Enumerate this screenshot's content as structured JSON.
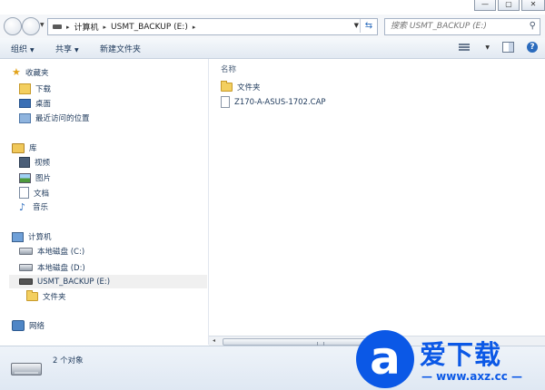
{
  "window": {
    "controls": {
      "minimize": "—",
      "maximize": "▢",
      "close": "✕"
    }
  },
  "addressbar": {
    "breadcrumb": [
      "计算机",
      "USMT_BACKUP (E:)"
    ],
    "search_placeholder": "搜索 USMT_BACKUP (E:)"
  },
  "toolbar": {
    "organize": "组织",
    "share": "共享",
    "new_folder": "新建文件夹"
  },
  "nav": {
    "favorites": "收藏夹",
    "favorite_items": [
      "下载",
      "桌面",
      "最近访问的位置"
    ],
    "libraries": "库",
    "library_items": [
      "视频",
      "图片",
      "文档",
      "音乐"
    ],
    "computer": "计算机",
    "drives": [
      "本地磁盘 (C:)",
      "本地磁盘 (D:)",
      "USMT_BACKUP (E:)"
    ],
    "subfolder": "文件夹",
    "network": "网络"
  },
  "content": {
    "column_name": "名称",
    "files": [
      {
        "name": "文件夹",
        "type": "folder"
      },
      {
        "name": "Z170-A-ASUS-1702.CAP",
        "type": "file"
      }
    ]
  },
  "status": {
    "count_text": "2 个对象"
  },
  "watermark": {
    "glyph": "a",
    "text": "爱下载",
    "url": "— www.axz.cc —"
  },
  "colors": {
    "accent": "#0b58e6",
    "nav_text": "#1e395b"
  }
}
